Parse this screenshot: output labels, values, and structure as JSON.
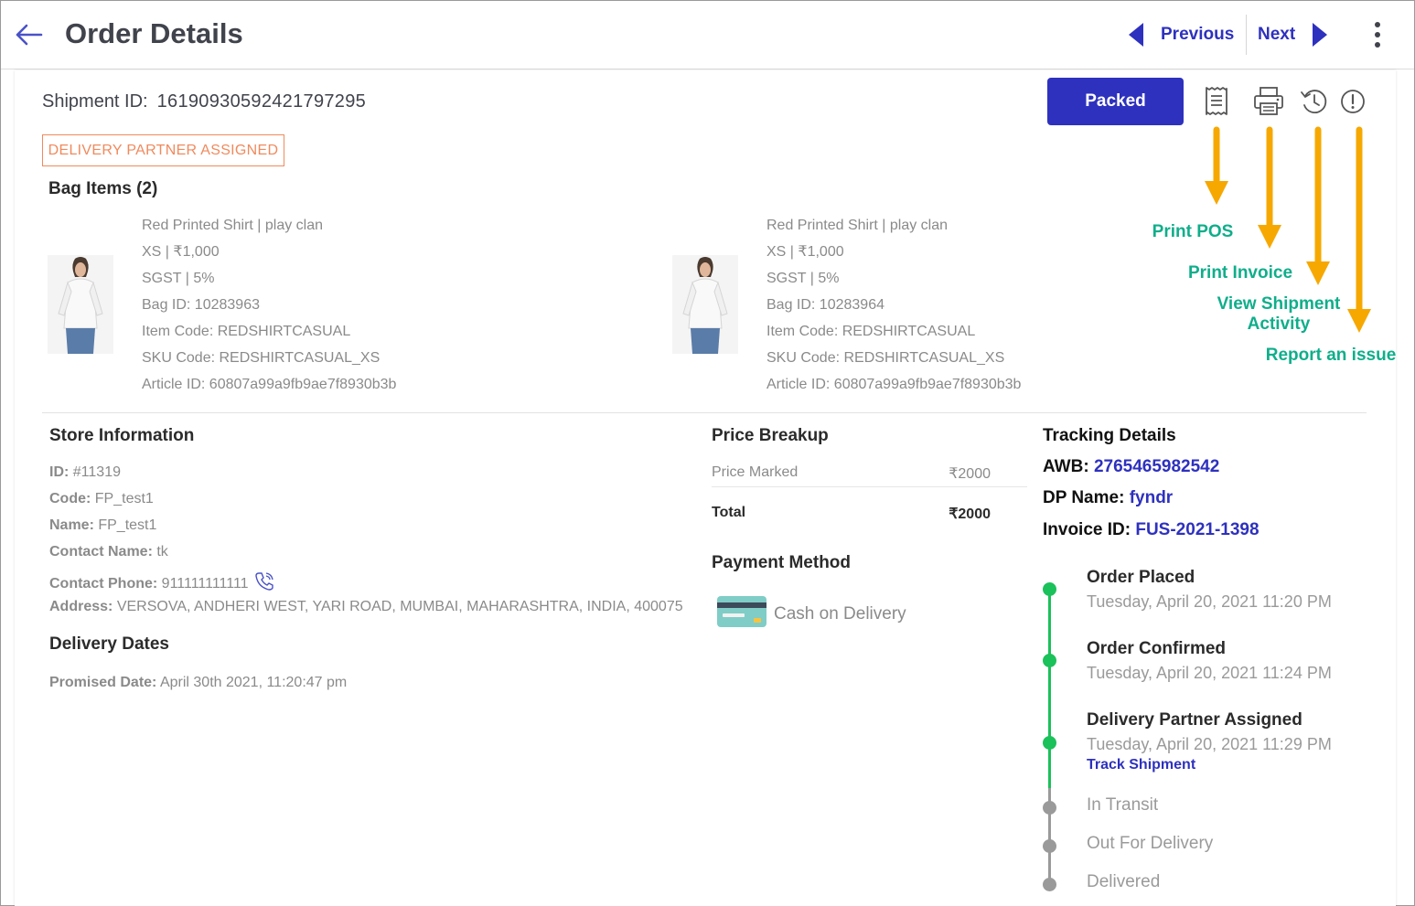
{
  "header": {
    "title": "Order Details",
    "previous_label": "Previous",
    "next_label": "Next"
  },
  "shipment": {
    "id_label": "Shipment ID:",
    "id_value": "16190930592421797295",
    "status_badge": "DELIVERY PARTNER ASSIGNED"
  },
  "actions": {
    "packed_label": "Packed",
    "icons": [
      "receipt-icon",
      "printer-icon",
      "history-icon",
      "alert-icon"
    ]
  },
  "annotations": {
    "print_pos": "Print POS",
    "print_invoice": "Print Invoice",
    "view_activity_line1": "View Shipment",
    "view_activity_line2": "Activity",
    "report_issue": "Report an issue",
    "color": "#0fae8a",
    "arrow_color": "#f6a800"
  },
  "bag": {
    "title": "Bag Items (2)",
    "items": [
      {
        "name": "Red Printed Shirt | play clan",
        "size_price": "XS | ₹1,000",
        "tax": "SGST | 5%",
        "bag_id": "Bag ID: 10283963",
        "item_code": "Item Code: REDSHIRTCASUAL",
        "sku_code": "SKU Code: REDSHIRTCASUAL_XS",
        "article_id": "Article ID: 60807a99a9fb9ae7f8930b3b"
      },
      {
        "name": "Red Printed Shirt | play clan",
        "size_price": "XS | ₹1,000",
        "tax": "SGST | 5%",
        "bag_id": "Bag ID: 10283964",
        "item_code": "Item Code: REDSHIRTCASUAL",
        "sku_code": "SKU Code: REDSHIRTCASUAL_XS",
        "article_id": "Article ID: 60807a99a9fb9ae7f8930b3b"
      }
    ]
  },
  "store": {
    "title": "Store Information",
    "id_label": "ID:",
    "id_value": "#11319",
    "code_label": "Code:",
    "code_value": "FP_test1",
    "name_label": "Name:",
    "name_value": "FP_test1",
    "contact_name_label": "Contact Name:",
    "contact_name_value": "tk",
    "contact_phone_label": "Contact Phone:",
    "contact_phone_value": "911111111111",
    "address_label": "Address:",
    "address_value": "VERSOVA, ANDHERI WEST, YARI ROAD, MUMBAI, MAHARASHTRA, INDIA, 400075"
  },
  "delivery_dates": {
    "title": "Delivery Dates",
    "promised_label": "Promised Date:",
    "promised_value": "April 30th 2021, 11:20:47 pm"
  },
  "price": {
    "title": "Price Breakup",
    "marked_label": "Price Marked",
    "marked_value": "₹2000",
    "total_label": "Total",
    "total_value": "₹2000"
  },
  "payment": {
    "title": "Payment Method",
    "method": "Cash on Delivery"
  },
  "tracking": {
    "title": "Tracking Details",
    "awb_label": "AWB:",
    "awb_value": "2765465982542",
    "dp_label": "DP Name:",
    "dp_value": "fyndr",
    "invoice_label": "Invoice ID:",
    "invoice_value": "FUS-2021-1398"
  },
  "timeline": {
    "done_color": "#1bc15a",
    "pending_color": "#9a9a9a",
    "steps": [
      {
        "title": "Order Placed",
        "date": "Tuesday, April 20, 2021 11:20 PM"
      },
      {
        "title": "Order Confirmed",
        "date": "Tuesday, April 20, 2021 11:24 PM"
      },
      {
        "title": "Delivery Partner Assigned",
        "date": "Tuesday, April 20, 2021 11:29 PM",
        "link": "Track Shipment"
      },
      {
        "title": "In Transit"
      },
      {
        "title": "Out For Delivery"
      },
      {
        "title": "Delivered"
      }
    ]
  }
}
